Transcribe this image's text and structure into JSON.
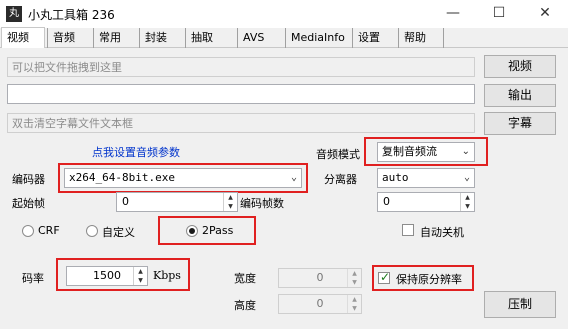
{
  "window": {
    "title": "小丸工具箱 236",
    "app_icon_glyph": "丸",
    "controls": {
      "minimize": "—",
      "maximize": "☐",
      "close": "✕"
    }
  },
  "tabs": [
    {
      "label": "视频",
      "active": true
    },
    {
      "label": "音频"
    },
    {
      "label": "常用"
    },
    {
      "label": "封装"
    },
    {
      "label": "抽取"
    },
    {
      "label": "AVS"
    },
    {
      "label": "MediaInfo"
    },
    {
      "label": "设置"
    },
    {
      "label": "帮助"
    }
  ],
  "input_file": {
    "placeholder": "可以把文件拖拽到这里",
    "button": "视频"
  },
  "output_file": {
    "value": "",
    "button": "输出"
  },
  "subtitle_file": {
    "placeholder": "双击清空字幕文件文本框",
    "button": "字幕"
  },
  "audio_settings_link": "点我设置音频参数",
  "audio_mode": {
    "label": "音频模式",
    "value": "复制音频流"
  },
  "encoder": {
    "label": "编码器",
    "value": "x264_64-8bit.exe"
  },
  "splitter": {
    "label": "分离器",
    "value": "auto"
  },
  "start_frame": {
    "label": "起始帧",
    "value": "0"
  },
  "encode_frames": {
    "label": "编码帧数",
    "value": "0"
  },
  "rate_control": {
    "options": [
      "CRF",
      "自定义",
      "2Pass"
    ],
    "selected": "2Pass"
  },
  "auto_shutdown": {
    "label": "自动关机",
    "checked": false
  },
  "bitrate": {
    "label": "码率",
    "value": "1500",
    "unit": "Kbps"
  },
  "width": {
    "label": "宽度",
    "value": "0"
  },
  "height": {
    "label": "高度",
    "value": "0"
  },
  "keep_resolution": {
    "label": "保持原分辨率",
    "checked": true
  },
  "compress_button": "压制",
  "colors": {
    "highlight_border": "#e02020",
    "link": "#0033cc",
    "check": "#1a7a1a"
  }
}
